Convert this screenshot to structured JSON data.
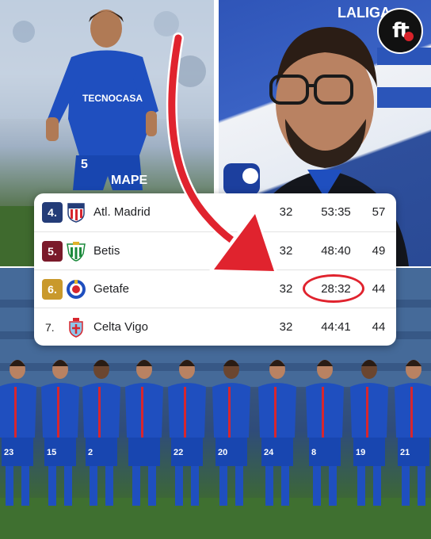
{
  "brand": {
    "logo_text": "ft"
  },
  "photo_player": {
    "sponsor": "TECNOCASA",
    "shorts_sponsor": "MAPE",
    "number": "5"
  },
  "photo_coach": {
    "backdrop_text": "LALIGA"
  },
  "standings": {
    "rows": [
      {
        "position": "4.",
        "team": "Atl. Madrid",
        "played": "32",
        "goals": "53:35",
        "points": "57",
        "badge_color": "#243c78",
        "crest": "atletico-madrid-crest"
      },
      {
        "position": "5.",
        "team": "Betis",
        "played": "32",
        "goals": "48:40",
        "points": "49",
        "badge_color": "#7a1a2a",
        "crest": "real-betis-crest"
      },
      {
        "position": "6.",
        "team": "Getafe",
        "played": "32",
        "goals": "28:32",
        "points": "44",
        "badge_color": "#c9992c",
        "crest": "getafe-crest"
      },
      {
        "position": "7.",
        "team": "Celta Vigo",
        "played": "32",
        "goals": "44:41",
        "points": "44",
        "badge_color": "",
        "crest": "celta-vigo-crest"
      }
    ],
    "highlight": {
      "team": "Getafe",
      "highlighted_value": "28:32",
      "highlight_color": "#e0232e"
    }
  },
  "photo_team": {
    "jersey_numbers": [
      "23",
      "15",
      "2",
      "",
      "22",
      "20",
      "24",
      "8",
      "19",
      "21"
    ],
    "kit_color": "#1f4fbf"
  },
  "colors": {
    "arrow": "#e0232e",
    "getafe_blue": "#1f4fbf"
  }
}
